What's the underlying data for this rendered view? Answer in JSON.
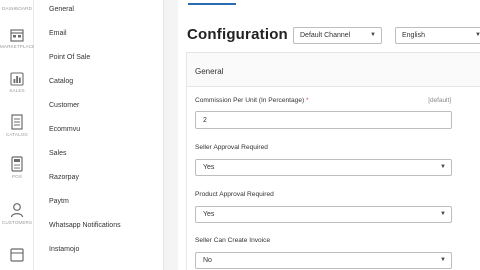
{
  "rail": {
    "items": [
      {
        "label": "Dashboard",
        "icon": "dashboard-icon"
      },
      {
        "label": "Marketplace",
        "icon": "marketplace-icon"
      },
      {
        "label": "Sales",
        "icon": "sales-chart-icon"
      },
      {
        "label": "Catalog",
        "icon": "catalog-icon"
      },
      {
        "label": "POS",
        "icon": "pos-terminal-icon"
      },
      {
        "label": "Customers",
        "icon": "customers-icon"
      },
      {
        "label": "",
        "icon": "cms-icon"
      }
    ]
  },
  "submenu": {
    "items": [
      "General",
      "Email",
      "Point Of Sale",
      "Catalog",
      "Customer",
      "Ecommvu",
      "Sales",
      "Razorpay",
      "Paytm",
      "Whatsapp Notifications",
      "Instamojo"
    ]
  },
  "header": {
    "title": "Configuration",
    "channel_select": "Default Channel",
    "locale_select": "English"
  },
  "card": {
    "title": "General",
    "fields": [
      {
        "label": "Commission Per Unit (In Percentage)",
        "required_mark": "*",
        "hint": "[default]",
        "value": "2"
      },
      {
        "label": "Seller Approval Required",
        "value": "Yes"
      },
      {
        "label": "Product Approval Required",
        "value": "Yes"
      },
      {
        "label": "Seller Can Create Invoice",
        "value": "No"
      }
    ]
  },
  "colors": {
    "accent": "#2b6cb0",
    "required": "#e53e3e",
    "icon": "#6b6b6b"
  }
}
